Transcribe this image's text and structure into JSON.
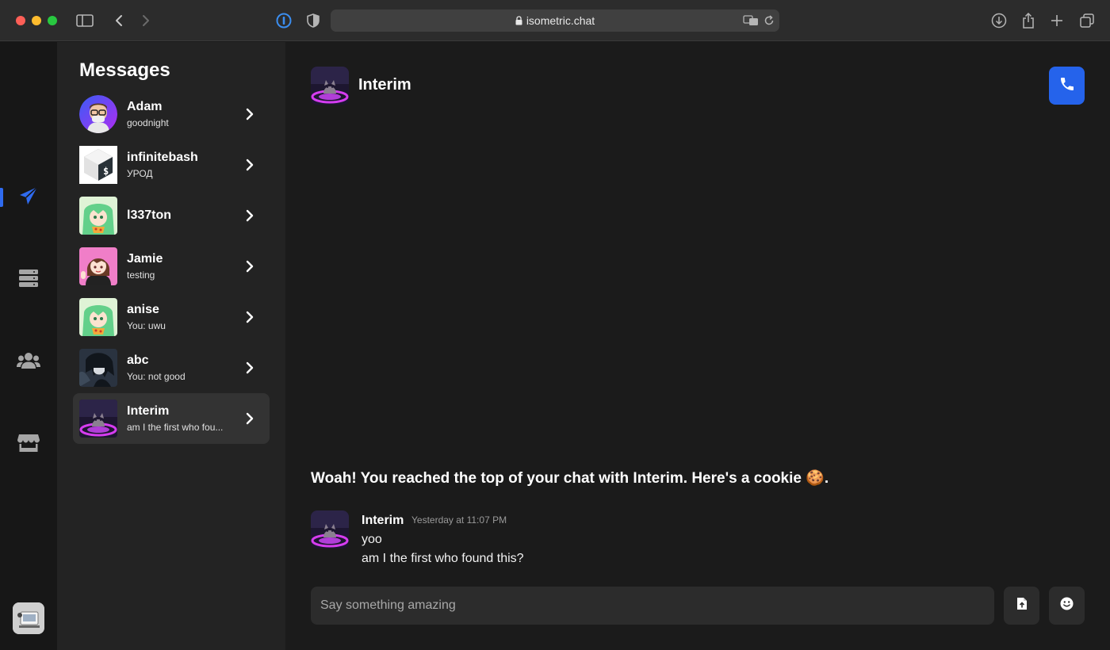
{
  "browser": {
    "url": "isometric.chat"
  },
  "sidebar": {
    "title": "Messages",
    "conversations": [
      {
        "name": "Adam",
        "preview": "goodnight"
      },
      {
        "name": "infinitebash",
        "preview": "УРОД"
      },
      {
        "name": "l337ton",
        "preview": ""
      },
      {
        "name": "Jamie",
        "preview": "testing"
      },
      {
        "name": "anise",
        "preview": "You: uwu"
      },
      {
        "name": "abc",
        "preview": "You: not good"
      },
      {
        "name": "Interim",
        "preview": "am I the first who fou..."
      }
    ]
  },
  "rail": {
    "items": [
      "paper-plane-icon",
      "server-icon",
      "users-icon",
      "store-icon"
    ]
  },
  "chat": {
    "title": "Interim",
    "intro": "Woah! You reached the top of your chat with Interim. Here's a cookie 🍪.",
    "message": {
      "author": "Interim",
      "timestamp": "Yesterday at 11:07 PM",
      "lines": [
        "yoo",
        "am I the first who found this?"
      ]
    },
    "composer_placeholder": "Say something amazing"
  },
  "colors": {
    "accent": "#2563eb",
    "active_icon": "#2f6bf0"
  }
}
